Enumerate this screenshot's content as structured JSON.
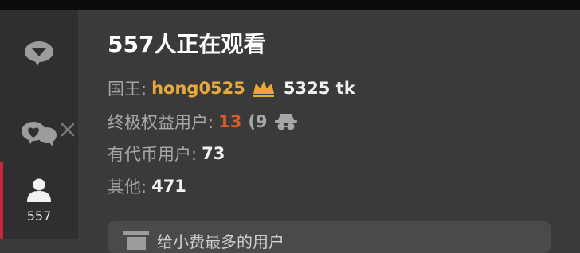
{
  "viewers": {
    "title": "557人正在观看",
    "king_label": "国王:",
    "king_name": "hong0525",
    "king_tokens": "5325 tk",
    "ultimate_label": "终极权益用户:",
    "ultimate_count": "13",
    "ultimate_hidden_open": "(9",
    "token_users_label": "有代币用户:",
    "token_users_count": "73",
    "other_label": "其他:",
    "other_count": "471"
  },
  "sidebar": {
    "users_count": "557",
    "icons": [
      "chat-icon",
      "private-chat-icon",
      "close-icon",
      "users-icon"
    ]
  },
  "tip": {
    "text": "给小费最多的用户"
  },
  "colors": {
    "accent": "#c8283c",
    "king": "#e9a93a",
    "ultimate": "#de5a2c"
  }
}
